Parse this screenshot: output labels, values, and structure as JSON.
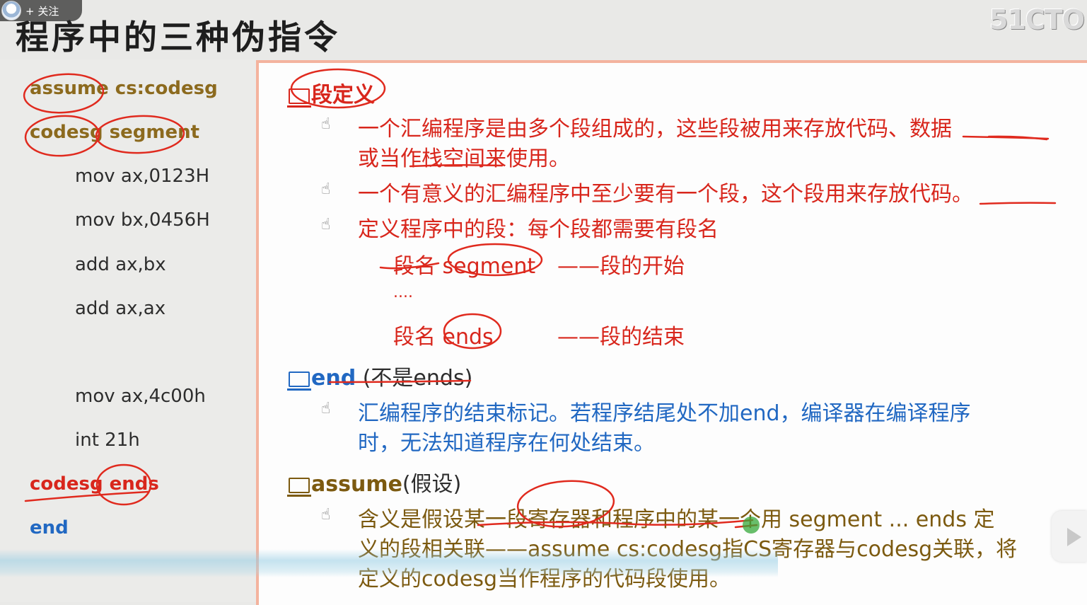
{
  "overlay": {
    "follow_label": "+ 关注"
  },
  "header": {
    "title": "程序中的三种伪指令",
    "logo": "51CTO"
  },
  "code_panel": {
    "lines": [
      "assume cs:codesg",
      "codesg segment",
      "mov ax,0123H",
      "mov bx,0456H",
      "add ax,bx",
      "add ax,ax",
      "mov ax,4c00h",
      "int 21h",
      "codesg ends",
      "end"
    ]
  },
  "slide": {
    "sec1": {
      "heading": "段定义",
      "b1_l1": "一个汇编程序是由多个段组成的，这些段被用来存放代码、数据",
      "b1_l2": "或当作栈空间来使用。",
      "b2": "一个有意义的汇编程序中至少要有一个段，这个段用来存放代码。",
      "b3": "定义程序中的段：每个段都需要有段名",
      "start_code": "段名 segment",
      "start_desc": "——段的开始",
      "dots": "....",
      "end_code": "段名 ends",
      "end_desc": "——段的结束"
    },
    "sec2": {
      "heading_kw": "end",
      "heading_note": " (不是ends)",
      "l1": "汇编程序的结束标记。若程序结尾处不加end，编译器在编译程序",
      "l2": "时，无法知道程序在何处结束。"
    },
    "sec3": {
      "heading_kw": "assume",
      "heading_note": "(假设)",
      "l1": "含义是假设某一段寄存器和程序中的某一个用 segment ... ends 定",
      "l2": "义的段相关联——assume cs:codesg指CS寄存器与codesg关联，将",
      "l3": "定义的codesg当作程序的代码段使用。"
    }
  },
  "colors": {
    "red": "#d8261c",
    "blue": "#2168c2",
    "brown": "#7c5a10",
    "accent_border": "#f4b39e"
  }
}
